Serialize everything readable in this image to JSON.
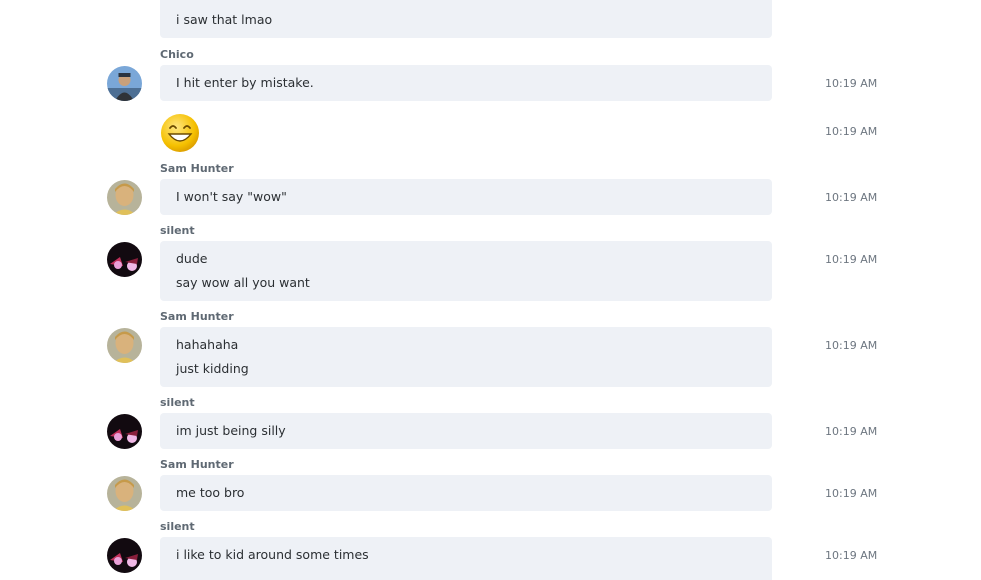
{
  "colors": {
    "bubble_bg": "#eef1f6",
    "sender_text": "#5f6973",
    "time_text": "#6d7680",
    "message_text": "#2b2f33"
  },
  "messages": [
    {
      "sender": "",
      "lines": [
        "i saw that lmao"
      ],
      "time": ""
    },
    {
      "sender": "Chico",
      "lines": [
        "I hit enter by mistake."
      ],
      "time": "10:19 AM"
    },
    {
      "sender": "",
      "emoji": "grinning-face-icon",
      "time": "10:19 AM"
    },
    {
      "sender": "Sam Hunter",
      "lines": [
        "I won't say \"wow\""
      ],
      "time": "10:19 AM"
    },
    {
      "sender": "silent",
      "lines": [
        "dude",
        "say wow all you want"
      ],
      "time": "10:19 AM"
    },
    {
      "sender": "Sam Hunter",
      "lines": [
        "hahahaha",
        "just kidding"
      ],
      "time": "10:19 AM"
    },
    {
      "sender": "silent",
      "lines": [
        "im just being silly"
      ],
      "time": "10:19 AM"
    },
    {
      "sender": "Sam Hunter",
      "lines": [
        "me too bro"
      ],
      "time": "10:19 AM"
    },
    {
      "sender": "silent",
      "lines": [
        "i like to kid around some times"
      ],
      "time": "10:19 AM"
    }
  ]
}
